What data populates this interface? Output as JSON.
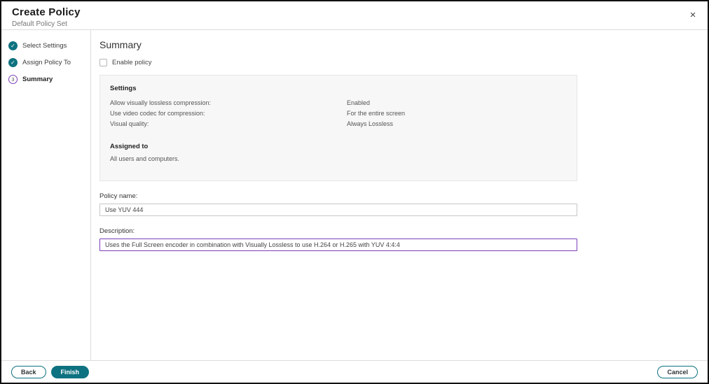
{
  "header": {
    "title": "Create Policy",
    "subtitle": "Default Policy Set"
  },
  "icons": {
    "close": "×",
    "check": "✓"
  },
  "steps": [
    {
      "label": "Select Settings",
      "state": "complete"
    },
    {
      "label": "Assign Policy To",
      "state": "complete"
    },
    {
      "label": "Summary",
      "state": "current",
      "number": "3"
    }
  ],
  "main": {
    "heading": "Summary",
    "enable_policy": {
      "label": "Enable policy",
      "checked": false
    },
    "summary_panel": {
      "settings_heading": "Settings",
      "settings": [
        {
          "label": "Allow visually lossless compression:",
          "value": "Enabled"
        },
        {
          "label": "Use video codec for compression:",
          "value": "For the entire screen"
        },
        {
          "label": "Visual quality:",
          "value": "Always Lossless"
        }
      ],
      "assigned_heading": "Assigned to",
      "assigned_value": "All users and computers."
    },
    "policy_name": {
      "label": "Policy name:",
      "value": "Use YUV 444"
    },
    "description": {
      "label": "Description:",
      "value": "Uses the Full Screen encoder in combination with Visually Lossless to use H.264 or H.265 with YUV 4:4:4"
    }
  },
  "footer": {
    "back_label": "Back",
    "finish_label": "Finish",
    "cancel_label": "Cancel"
  },
  "colors": {
    "teal": "#0e7280",
    "purple": "#7b3fb8"
  }
}
